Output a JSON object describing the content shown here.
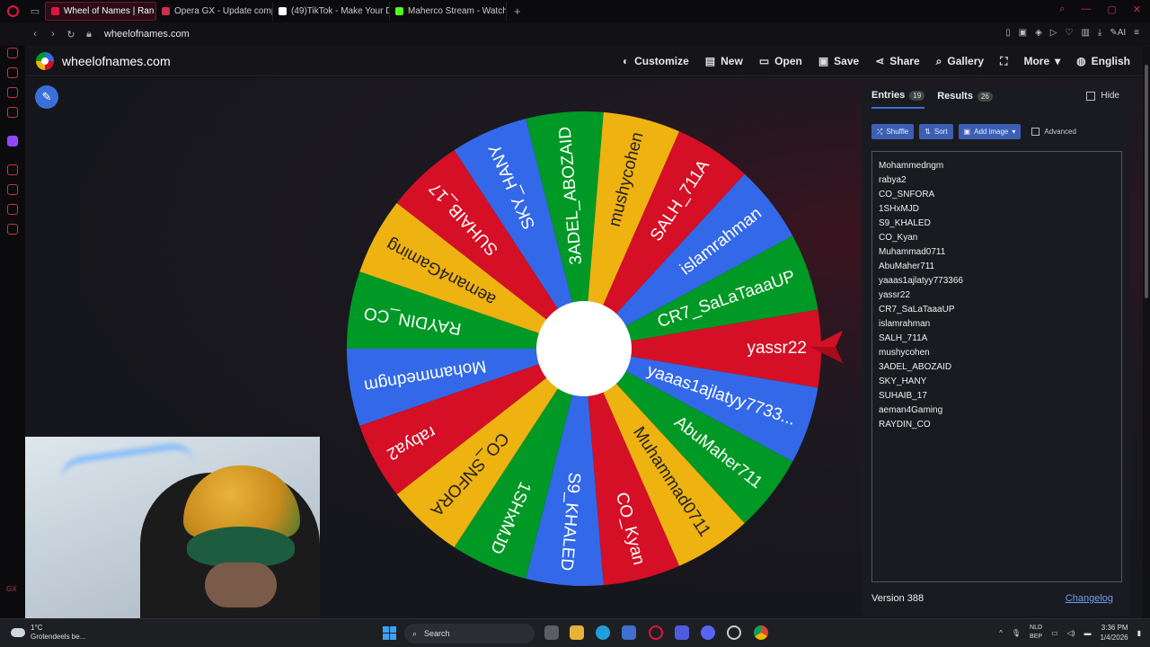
{
  "browser": {
    "tabs": [
      {
        "label": "Wheel of Names | Ran",
        "color": "#e0163f",
        "active": true
      },
      {
        "label": "Opera GX - Update comp",
        "color": "#c9304c",
        "active": false
      },
      {
        "label": "(49)TikTok - Make Your D",
        "color": "#ffffff",
        "active": false
      },
      {
        "label": "Maherco Stream - Watch L",
        "color": "#53fc18",
        "active": false
      }
    ],
    "url": "wheelofnames.com"
  },
  "site": {
    "title": "wheelofnames.com",
    "menu": [
      {
        "label": "Customize",
        "icon": "palette-icon"
      },
      {
        "label": "New",
        "icon": "file-icon"
      },
      {
        "label": "Open",
        "icon": "folder-icon"
      },
      {
        "label": "Save",
        "icon": "save-icon"
      },
      {
        "label": "Share",
        "icon": "share-icon"
      },
      {
        "label": "Gallery",
        "icon": "search-icon"
      },
      {
        "label": "",
        "icon": "fullscreen-icon"
      },
      {
        "label": "More",
        "icon": "chevron-down-icon"
      },
      {
        "label": "English",
        "icon": "globe-icon"
      }
    ]
  },
  "wheel": {
    "colors": [
      "#d50f25",
      "#3369e8",
      "#009925",
      "#eeb211"
    ],
    "segments": [
      "yassr22",
      "yaaas1ajlatyy7733...",
      "AbuMaher711",
      "Muhammad0711",
      "CO_Kyan",
      "S9_KHALED",
      "1SHxMJD",
      "CO_SNFORA",
      "rabya2",
      "Mohammedngm",
      "RAYDIN_CO",
      "aeman4Gaming",
      "SUHAIB_17",
      "SKY_HANY",
      "3ADEL_ABOZAID",
      "mushycohen",
      "SALH_711A",
      "islamrahman",
      "CR7_SaLaTaaaUP"
    ]
  },
  "panel": {
    "tabs": [
      {
        "label": "Entries",
        "count": "19"
      },
      {
        "label": "Results",
        "count": "26"
      }
    ],
    "hide_label": "Hide",
    "toolbar": {
      "shuffle": "Shuffle",
      "sort": "Sort",
      "add_image": "Add image",
      "advanced": "Advanced"
    },
    "entries": [
      "Mohammedngm",
      "rabya2",
      "CO_SNFORA",
      "1SHxMJD",
      "S9_KHALED",
      "CO_Kyan",
      "Muhammad0711",
      "AbuMaher711",
      "yaaas1ajlatyy773366",
      "yassr22",
      "CR7_SaLaTaaaUP",
      "islamrahman",
      "SALH_711A",
      "mushycohen",
      "3ADEL_ABOZAID",
      "SKY_HANY",
      "SUHAIB_17",
      "aeman4Gaming",
      "RAYDIN_CO"
    ],
    "version": "Version 388",
    "changelog": "Changelog"
  },
  "taskbar": {
    "temp": "1°C",
    "weather": "Grotendeels be...",
    "search": "Search",
    "lang1": "NLD",
    "lang2": "BEP",
    "time": "3:36 PM",
    "date": "1/4/2026"
  }
}
